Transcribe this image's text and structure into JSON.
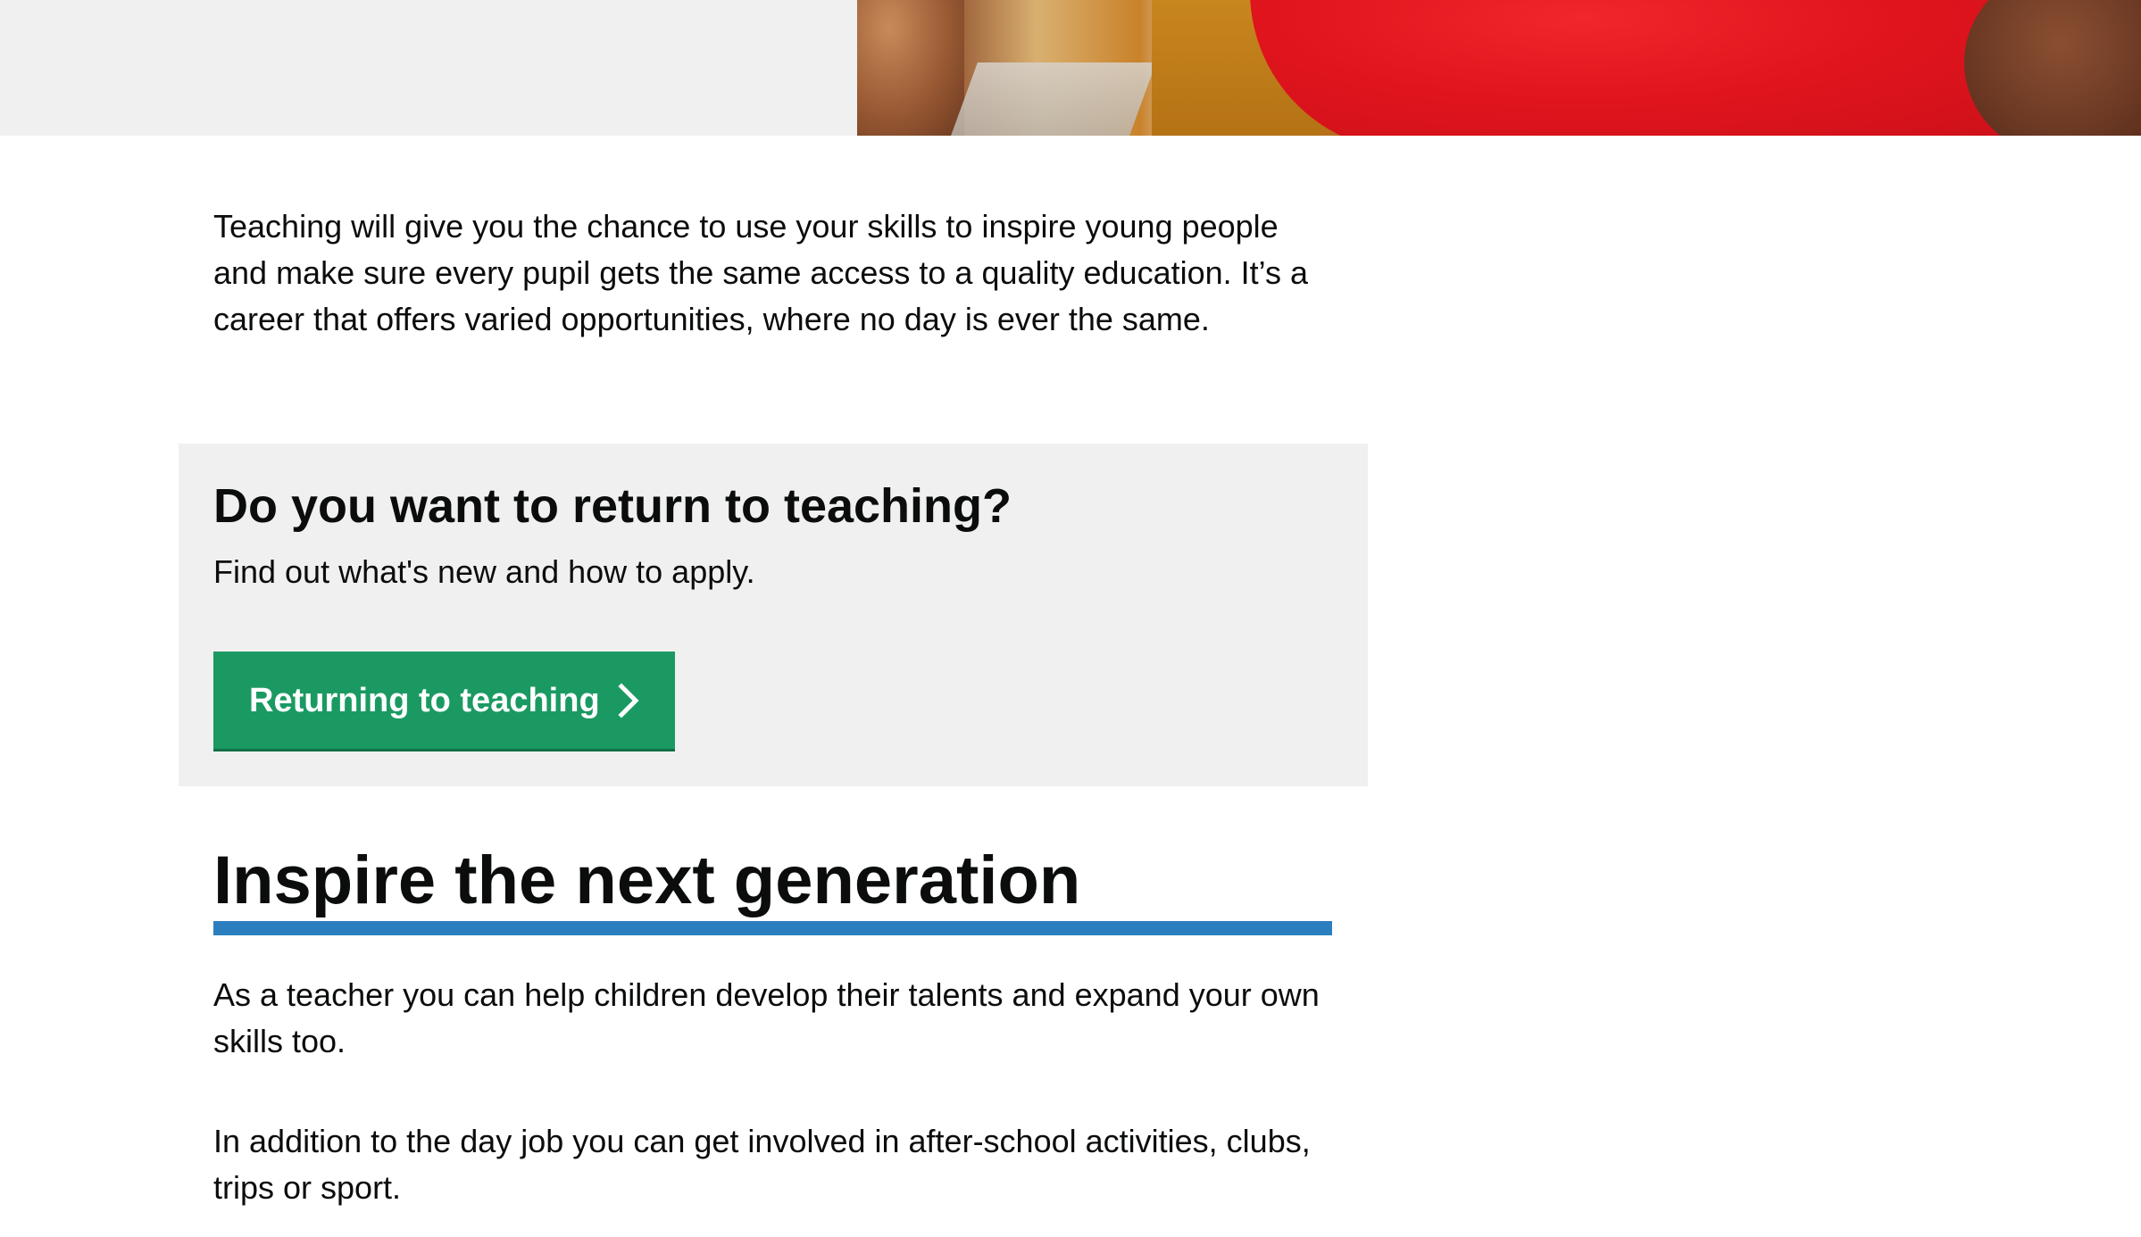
{
  "intro": {
    "text": "Teaching will give you the chance to use your skills to inspire young people and make sure every pupil gets the same access to a quality education. It’s a career that offers varied opportunities, where no day is ever the same."
  },
  "callout": {
    "title": "Do you want to return to teaching?",
    "text": "Find out what's new and how to apply.",
    "button_label": "Returning to teaching",
    "button_icon": "chevron-right-icon",
    "button_color": "#1a9a62",
    "background": "#f0f0f0"
  },
  "section": {
    "heading": "Inspire the next generation",
    "rule_color": "#2b7fbf",
    "paragraphs": [
      "As a teacher you can help children develop their talents and expand your own skills too.",
      "In addition to the day job you can get involved in after-school activities, clubs, trips or sport."
    ]
  }
}
